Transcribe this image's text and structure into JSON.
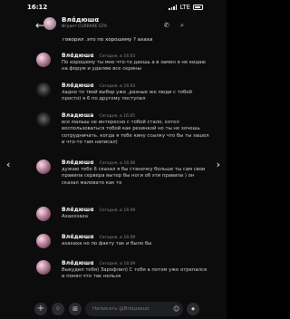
{
  "status": {
    "time": "16:12",
    "network": "LTE"
  },
  "header": {
    "title": "Влάдюшα",
    "subtitle": "Играет CURRARE GTA"
  },
  "previous_text": "говорил .это по хорошему ? ахаха",
  "messages": [
    {
      "author": "Влάдюшα",
      "time": "Сегодня, в 16:03",
      "text": "По хорошему ты мне что-то даешь а в замен я не кидаю на форум и удаляю все скрины"
    },
    {
      "author": "Влάдюшα",
      "time": "Сегодня, в 16:03",
      "text": "ладно то твой выбор уже ,разные же люди с тобой просто) я 6 по другому поступил",
      "dark_avatar": true
    },
    {
      "author": "Владюша",
      "time": "Сегодня, в 16:05",
      "text": "все малыш не интересно с тобой стало, хотел воспользоваться тобой как резинкой но ты не хочешь сотрудничать. когда я тебе кину ссылку что бы ты зашел и что-то там написал)"
    },
    {
      "author": "Влάдюшα",
      "time": "Сегодня, в 16:06",
      "text": "дужаю тебе 6 сказал я бы станочку больше ты сам свои правила сервера вытер бы ноги об эти правила ) он сказал маловато как то"
    },
    {
      "author": "Влάдюшα",
      "time": "Сегодня, в 16:09",
      "text": "Ахахххаха"
    },
    {
      "author": "Влάдюшα",
      "time": "Сегодня, в 16:09",
      "text": "ахахаха но по факту так и было бы"
    },
    {
      "author": "Влάдюшα",
      "time": "Сегодня, в 16:09",
      "text": "Выкудил тебя) Зарофлил) С тебя а потом уже отрепался и понял что так нельзя"
    }
  ],
  "composer": {
    "placeholder": "Написать @Влάдюшα"
  }
}
